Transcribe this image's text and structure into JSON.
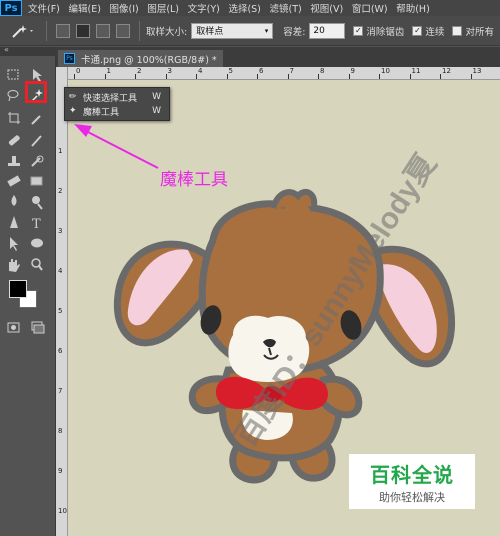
{
  "app": {
    "logo": "Ps"
  },
  "menubar": {
    "items": [
      "文件(F)",
      "编辑(E)",
      "图像(I)",
      "图层(L)",
      "文字(Y)",
      "选择(S)",
      "滤镜(T)",
      "视图(V)",
      "窗口(W)",
      "帮助(H)"
    ]
  },
  "options": {
    "sample_size_label": "取样大小:",
    "sample_size_value": "取样点",
    "tolerance_label": "容差:",
    "tolerance_value": "20",
    "antialias_label": "消除锯齿",
    "contiguous_label": "连续",
    "all_layers_label": "对所有"
  },
  "document": {
    "tab_title": "卡通.png @ 100%(RGB/8#) *"
  },
  "ruler": {
    "top_ticks": [
      "0",
      "1",
      "2",
      "3",
      "4",
      "5",
      "6",
      "7",
      "8",
      "9",
      "10",
      "11",
      "12",
      "13"
    ],
    "left_ticks": [
      "1",
      "2",
      "3",
      "4",
      "5",
      "6",
      "7",
      "8",
      "9",
      "10"
    ]
  },
  "flyout": {
    "items": [
      {
        "label": "快速选择工具",
        "shortcut": "W",
        "icon": "quick-selection-icon"
      },
      {
        "label": "魔棒工具",
        "shortcut": "W",
        "icon": "magic-wand-icon"
      }
    ]
  },
  "annotation": {
    "label": "魔棒工具",
    "color": "#e828e6"
  },
  "watermark": {
    "text": "百度ID：sunnyMelody夏"
  },
  "logo": {
    "main": "百科全说",
    "sub": "助你轻松解决"
  },
  "colors": {
    "highlight": "#e8242a",
    "canvas_bg": "#d8d5bd",
    "dog_fur": "#a8703f",
    "bow": "#d81e2a"
  }
}
